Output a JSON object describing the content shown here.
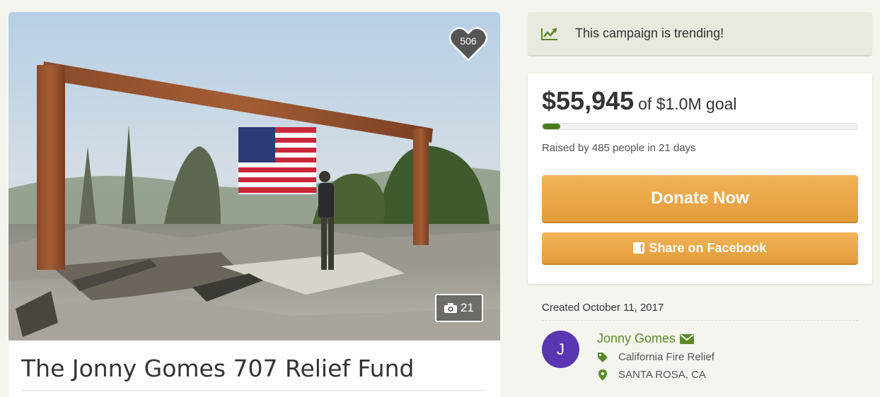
{
  "campaign": {
    "title": "The Jonny Gomes 707 Relief Fund",
    "hearts": "506",
    "photo_count": "21",
    "trending_text": "This campaign is trending!"
  },
  "funding": {
    "raised": "$55,945",
    "goal_text": "of $1.0M goal",
    "progress_fraction": 0.056,
    "raised_by": "Raised by 485 people in 21 days",
    "donate_label": "Donate Now",
    "share_label": "Share on Facebook"
  },
  "organizer": {
    "created": "Created October 11, 2017",
    "avatar_letter": "J",
    "name": "Jonny Gomes",
    "category": "California Fire Relief",
    "location": "SANTA ROSA, CA"
  },
  "icons": {
    "trending": "trending-chart-icon",
    "heart": "heart-icon",
    "camera": "camera-icon",
    "facebook": "facebook-icon",
    "mail": "mail-icon",
    "tag": "tag-icon",
    "location": "map-pin-icon"
  },
  "colors": {
    "accent_green": "#5b8a29",
    "progress_green": "#4d7a21",
    "button_orange": "#e9a744",
    "avatar_purple": "#5a36b0",
    "trend_bg": "#e8e9df"
  }
}
